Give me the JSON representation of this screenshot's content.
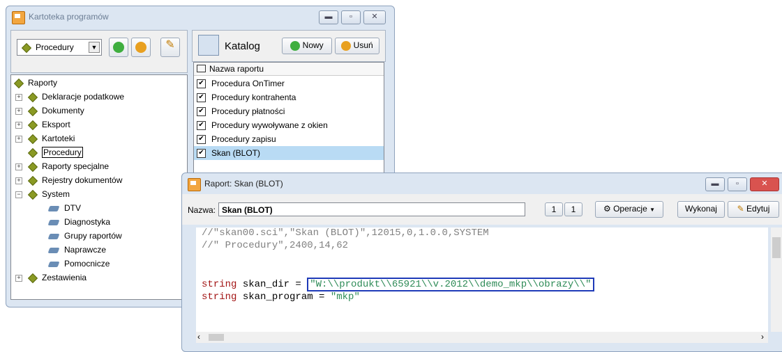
{
  "back_window": {
    "title": "Kartoteka programów",
    "dropdown_value": "Procedury",
    "catalog_label": "Katalog",
    "new_label": "Nowy",
    "delete_label": "Usuń",
    "list_header": "Nazwa raportu",
    "tree": {
      "root": "Raporty",
      "items": [
        "Deklaracje podatkowe",
        "Dokumenty",
        "Eksport",
        "Kartoteki",
        "Procedury",
        "Raporty specjalne",
        "Rejestry dokumentów",
        "System"
      ],
      "system_children": [
        "DTV",
        "Diagnostyka",
        "Grupy raportów",
        "Naprawcze",
        "Pomocnicze"
      ],
      "last": "Zestawienia"
    },
    "reports": [
      "Procedura OnTimer",
      "Procedury kontrahenta",
      "Procedury płatności",
      "Procedury wywoływane z okien",
      "Procedury zapisu",
      "Skan (BLOT)"
    ]
  },
  "front_window": {
    "title": "Raport: Skan (BLOT)",
    "name_label": "Nazwa:",
    "name_value": "Skan (BLOT)",
    "page_current": "1",
    "page_total": "1",
    "operations_label": "Operacje",
    "execute_label": "Wykonaj",
    "edit_label": "Edytuj",
    "code": {
      "line1": "//\"skan00.sci\",\"Skan (BLOT)\",12015,0,1.0.0,SYSTEM",
      "line2": "//\" Procedury\",2400,14,62",
      "kw1": "string",
      "var1": " skan_dir = ",
      "str1": "\"W:\\\\produkt\\\\65921\\\\v.2012\\\\demo_mkp\\\\obrazy\\\\\"",
      "kw2": "string",
      "var2": " skan_program = ",
      "str2": "\"mkp\""
    }
  },
  "colors": {
    "highlight_box": "#1e3ab8",
    "selected_row": "#b9dbf4",
    "close_button": "#d9534f"
  }
}
